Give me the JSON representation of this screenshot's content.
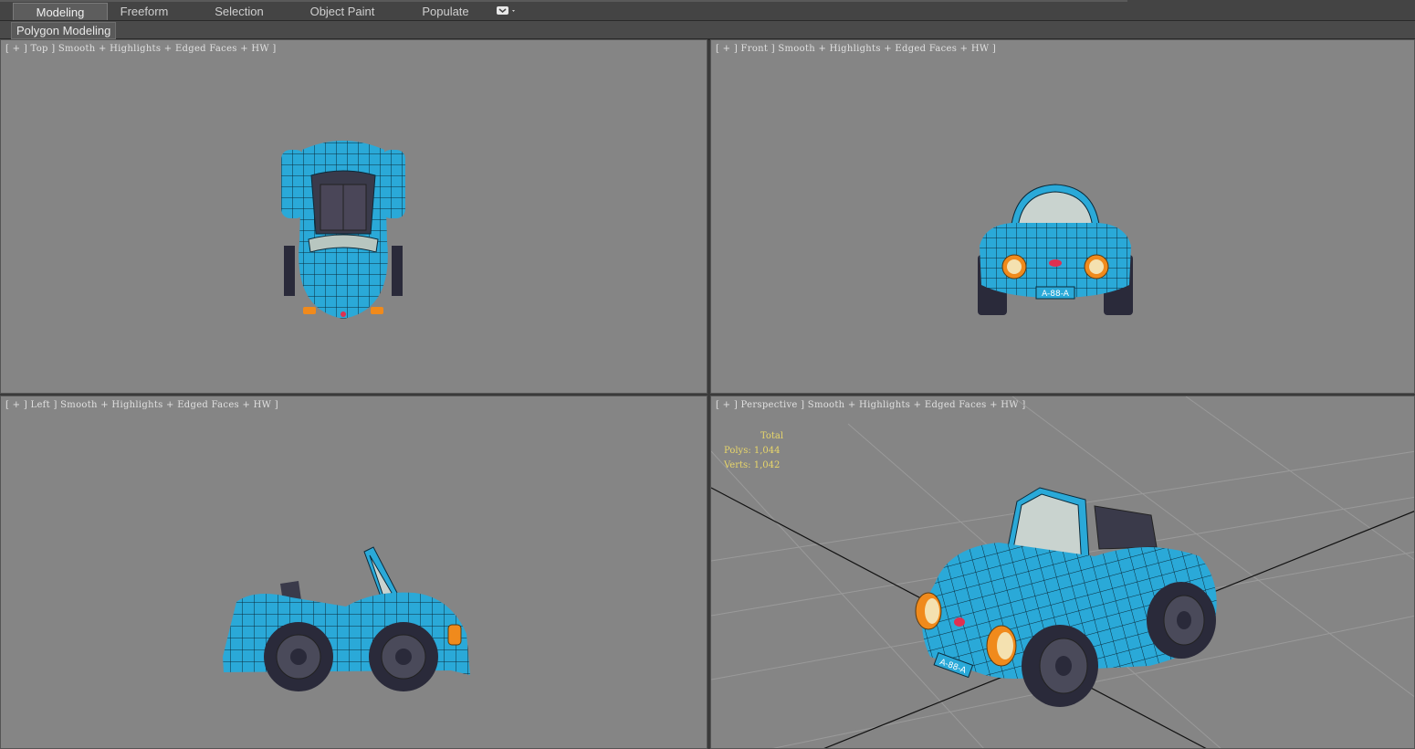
{
  "ribbon": {
    "tabs": [
      {
        "label": "Modeling",
        "active": true
      },
      {
        "label": "Freeform",
        "active": false
      },
      {
        "label": "Selection",
        "active": false
      },
      {
        "label": "Object Paint",
        "active": false
      },
      {
        "label": "Populate",
        "active": false
      }
    ],
    "panel_label": "Polygon Modeling"
  },
  "viewports": {
    "top": {
      "label": "[ + ] Top ] Smooth + Highlights + Edged Faces + HW ]"
    },
    "front": {
      "label": "[ + ] Front ] Smooth + Highlights + Edged Faces + HW ]"
    },
    "left": {
      "label": "[ + ] Left ] Smooth + Highlights + Edged Faces + HW ]"
    },
    "perspective": {
      "label": "[ + ] Perspective ] Smooth + Highlights + Edged Faces + HW ]",
      "stats": {
        "total_label": "Total",
        "polys_label": "Polys:",
        "polys_value": "1,044",
        "verts_label": "Verts:",
        "verts_value": "1,042"
      }
    }
  },
  "license_plate": "A-88-A",
  "colors": {
    "viewport_bg": "#858585",
    "car_body": "#2aa9d8",
    "wire": "#0b2a3a",
    "stats_text": "#e8d66a"
  }
}
